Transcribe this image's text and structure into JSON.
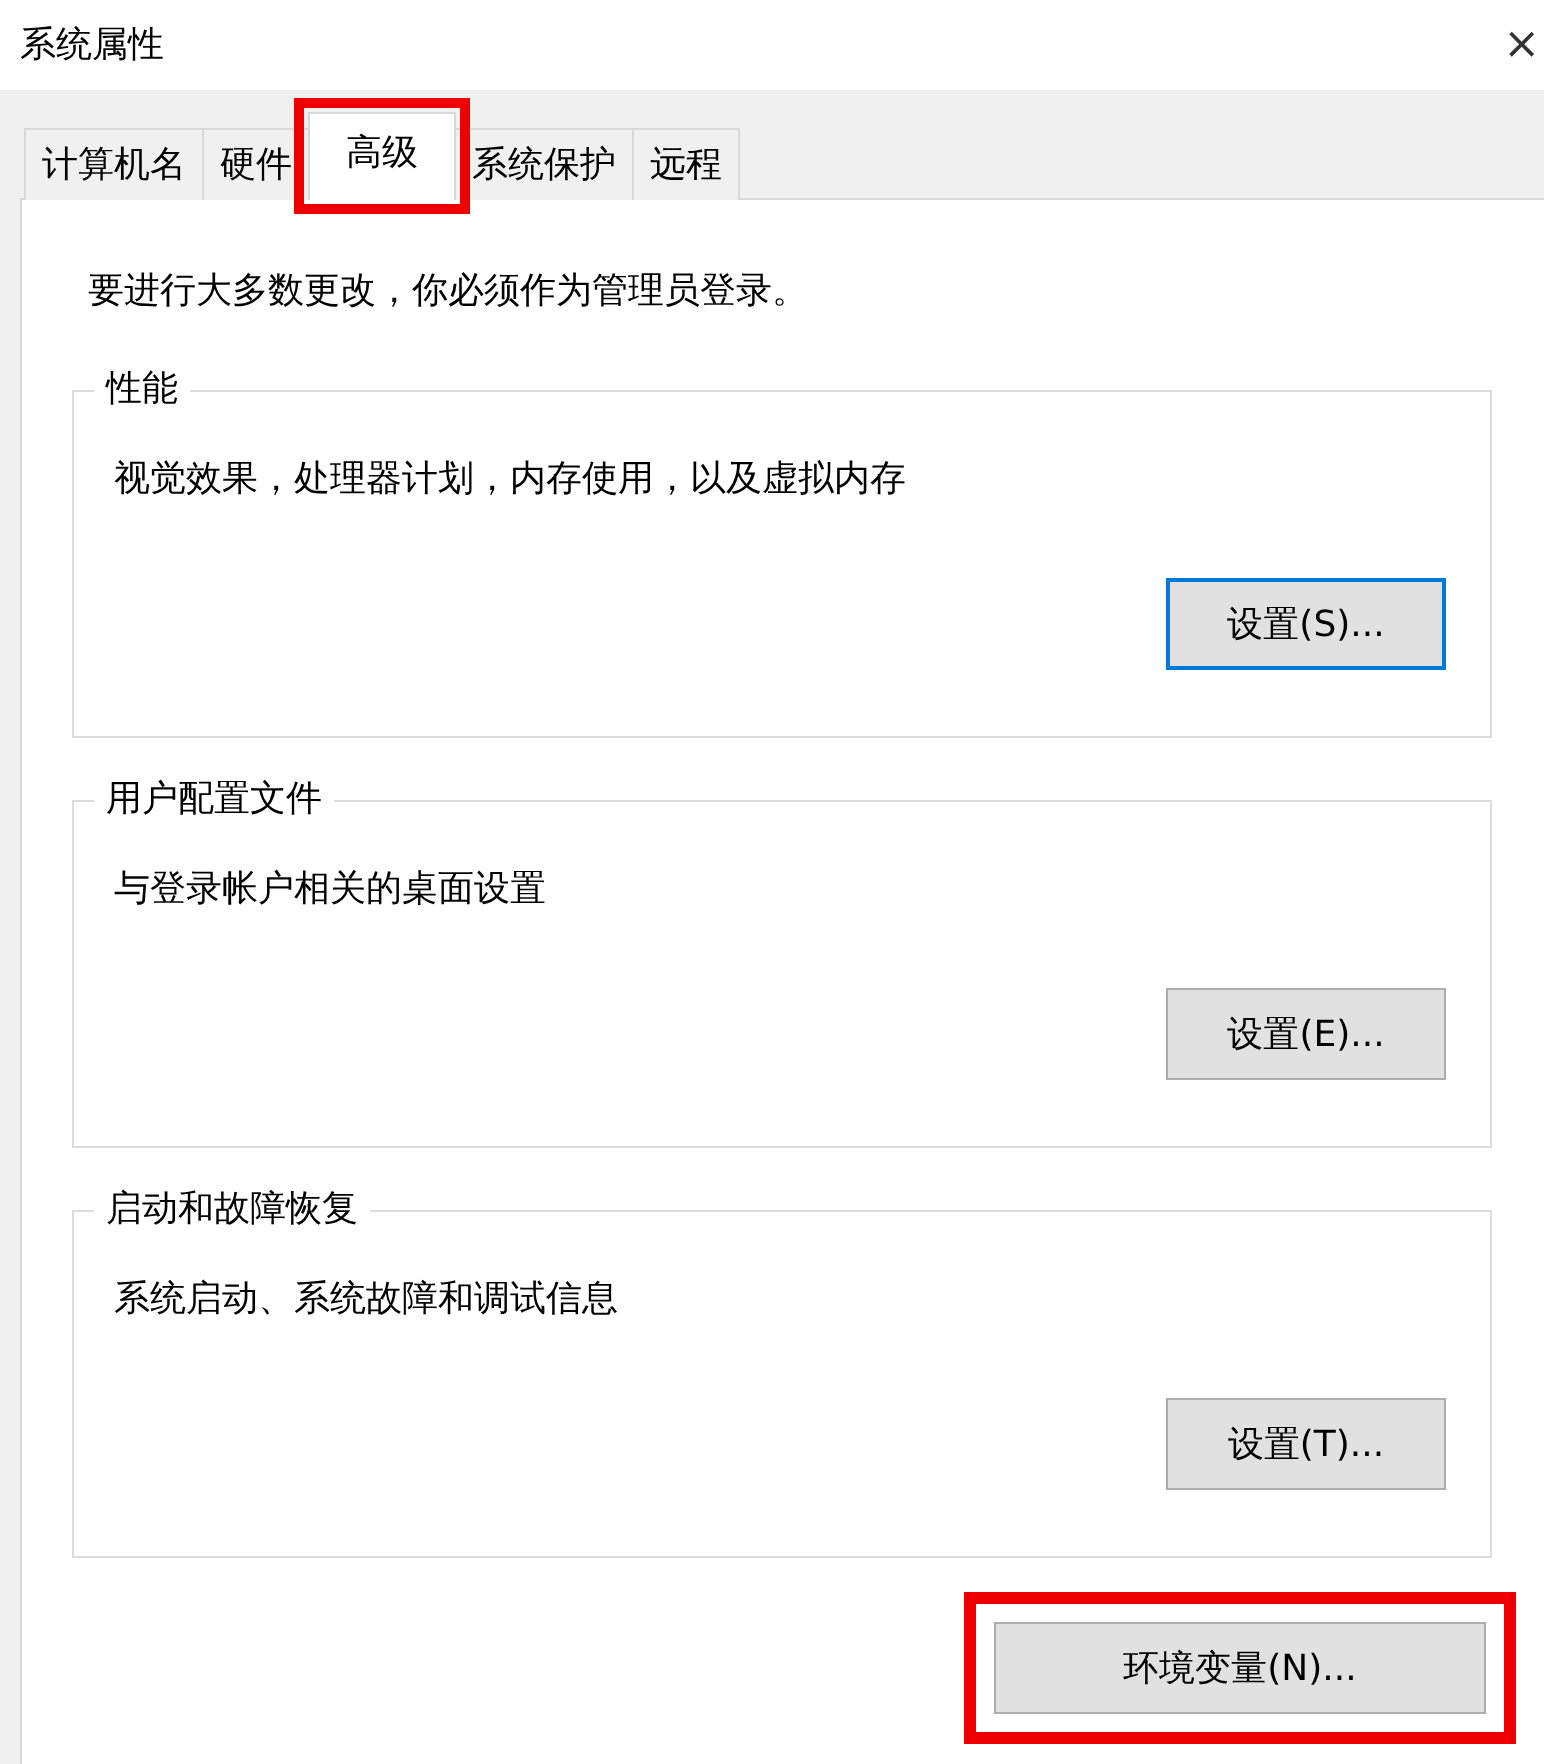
{
  "window": {
    "title": "系统属性",
    "close": "×"
  },
  "tabs": [
    {
      "label": "计算机名",
      "selected": false,
      "highlighted": false
    },
    {
      "label": "硬件",
      "selected": false,
      "highlighted": false
    },
    {
      "label": "高级",
      "selected": true,
      "highlighted": true
    },
    {
      "label": "系统保护",
      "selected": false,
      "highlighted": false
    },
    {
      "label": "远程",
      "selected": false,
      "highlighted": false
    }
  ],
  "notice": "要进行大多数更改，你必须作为管理员登录。",
  "groups": [
    {
      "title": "性能",
      "description": "视觉效果，处理器计划，内存使用，以及虚拟内存",
      "button": {
        "label": "设置(S)...",
        "focused": true
      }
    },
    {
      "title": "用户配置文件",
      "description": "与登录帐户相关的桌面设置",
      "button": {
        "label": "设置(E)...",
        "focused": false
      }
    },
    {
      "title": "启动和故障恢复",
      "description": "系统启动、系统故障和调试信息",
      "button": {
        "label": "设置(T)...",
        "focused": false
      }
    }
  ],
  "env_button": {
    "label": "环境变量(N)...",
    "highlighted": true
  }
}
